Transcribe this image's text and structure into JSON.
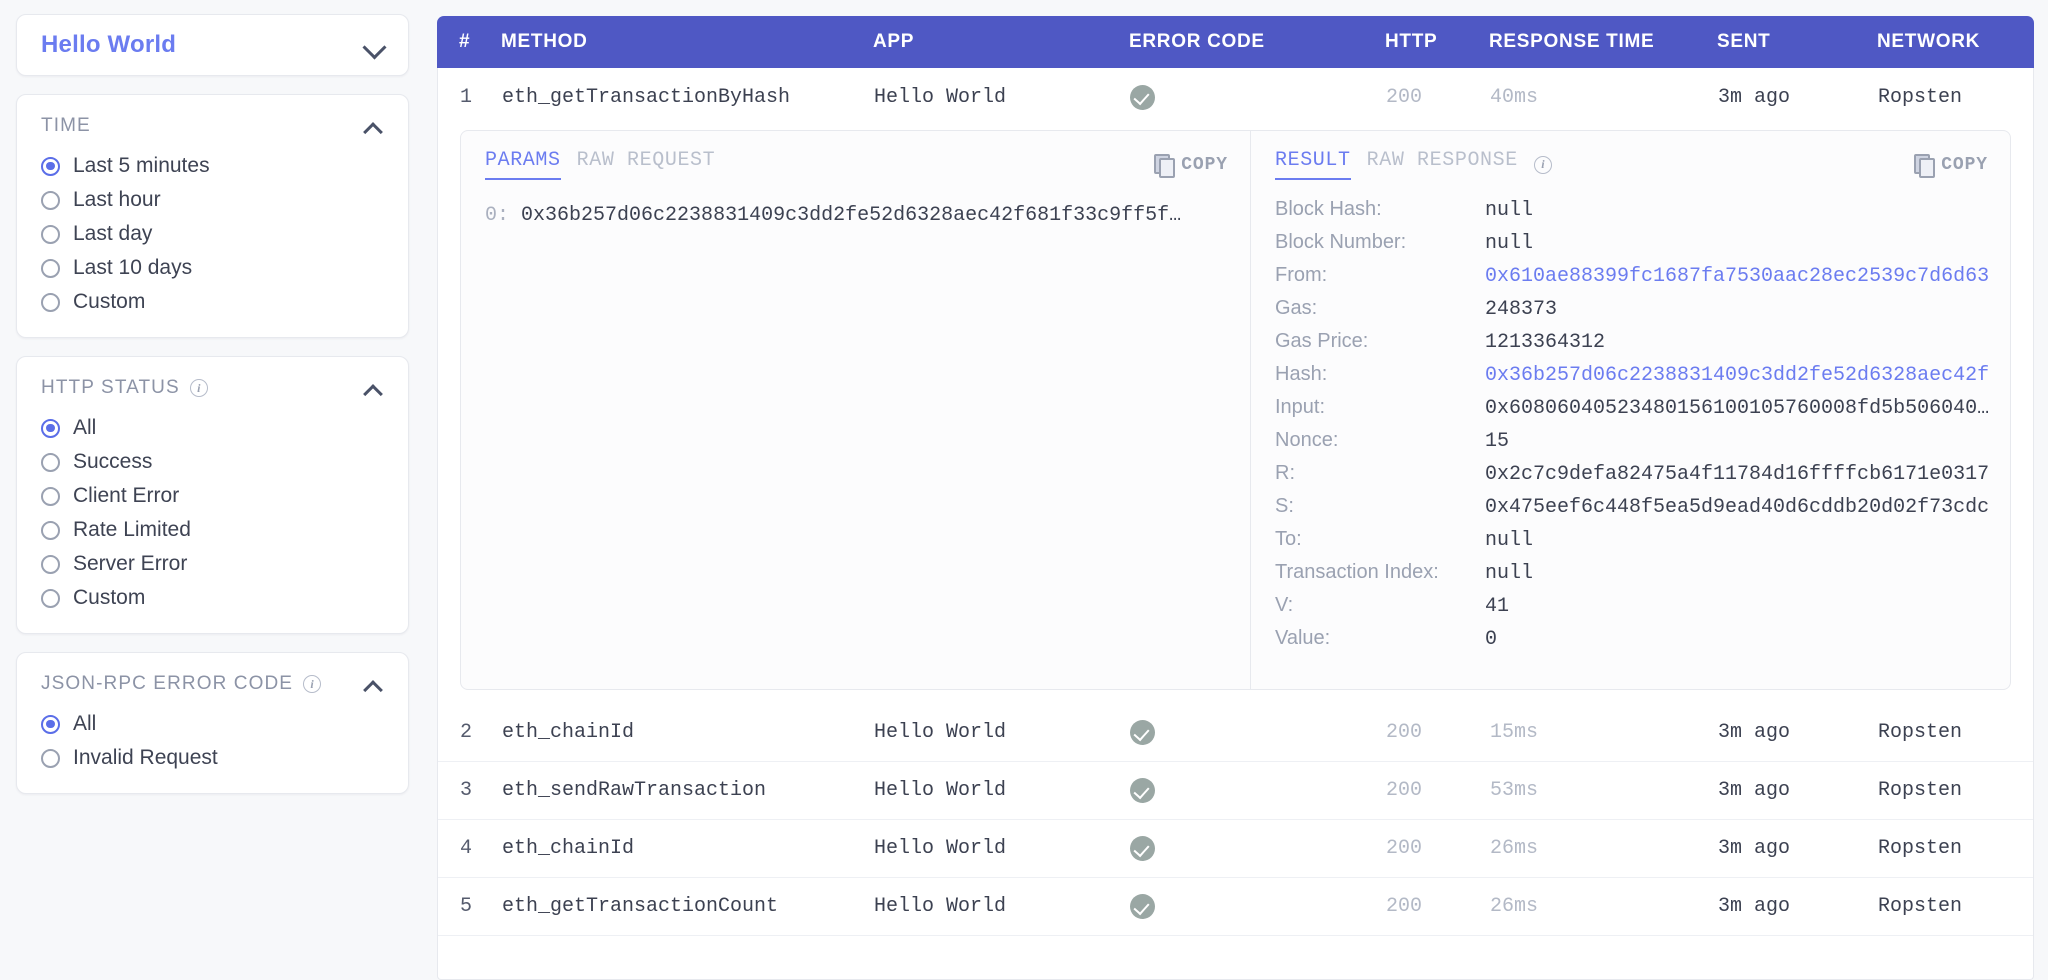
{
  "sidebar": {
    "app_selector": {
      "value": "Hello World",
      "chevron": "chevron-down-icon"
    },
    "sections": [
      {
        "title": "TIME",
        "has_info": false,
        "collapsed": false,
        "options": [
          {
            "label": "Last 5 minutes",
            "selected": true
          },
          {
            "label": "Last hour",
            "selected": false
          },
          {
            "label": "Last day",
            "selected": false
          },
          {
            "label": "Last 10 days",
            "selected": false
          },
          {
            "label": "Custom",
            "selected": false
          }
        ]
      },
      {
        "title": "HTTP STATUS",
        "has_info": true,
        "collapsed": false,
        "options": [
          {
            "label": "All",
            "selected": true
          },
          {
            "label": "Success",
            "selected": false
          },
          {
            "label": "Client Error",
            "selected": false
          },
          {
            "label": "Rate Limited",
            "selected": false
          },
          {
            "label": "Server Error",
            "selected": false
          },
          {
            "label": "Custom",
            "selected": false
          }
        ]
      },
      {
        "title": "JSON-RPC ERROR CODE",
        "has_info": true,
        "collapsed": false,
        "options": [
          {
            "label": "All",
            "selected": true
          },
          {
            "label": "Invalid Request",
            "selected": false
          }
        ]
      }
    ]
  },
  "table": {
    "columns": {
      "num": "#",
      "method": "METHOD",
      "app": "APP",
      "error_code": "ERROR CODE",
      "http": "HTTP",
      "response_time": "RESPONSE TIME",
      "sent": "SENT",
      "network": "NETWORK"
    },
    "header_bg": "#4f58c4",
    "rows": [
      {
        "num": "1",
        "method": "eth_getTransactionByHash",
        "app": "Hello World",
        "status_icon": "success-check-icon",
        "http": "200",
        "response_time": "40ms",
        "sent": "3m ago",
        "network": "Ropsten",
        "expanded": true
      },
      {
        "num": "2",
        "method": "eth_chainId",
        "app": "Hello World",
        "status_icon": "success-check-icon",
        "http": "200",
        "response_time": "15ms",
        "sent": "3m ago",
        "network": "Ropsten",
        "expanded": false
      },
      {
        "num": "3",
        "method": "eth_sendRawTransaction",
        "app": "Hello World",
        "status_icon": "success-check-icon",
        "http": "200",
        "response_time": "53ms",
        "sent": "3m ago",
        "network": "Ropsten",
        "expanded": false
      },
      {
        "num": "4",
        "method": "eth_chainId",
        "app": "Hello World",
        "status_icon": "success-check-icon",
        "http": "200",
        "response_time": "26ms",
        "sent": "3m ago",
        "network": "Ropsten",
        "expanded": false
      },
      {
        "num": "5",
        "method": "eth_getTransactionCount",
        "app": "Hello World",
        "status_icon": "success-check-icon",
        "http": "200",
        "response_time": "26ms",
        "sent": "3m ago",
        "network": "Ropsten",
        "expanded": false
      }
    ]
  },
  "detail": {
    "request": {
      "tabs": [
        {
          "label": "PARAMS",
          "active": true
        },
        {
          "label": "RAW REQUEST",
          "active": false
        }
      ],
      "copy_label": "COPY",
      "params": [
        {
          "index": "0:",
          "value": "0x36b257d06c2238831409c3dd2fe52d6328aec42f681f33c9ff5f…"
        }
      ]
    },
    "response": {
      "tabs": [
        {
          "label": "RESULT",
          "active": true
        },
        {
          "label": "RAW RESPONSE",
          "active": false
        }
      ],
      "has_info": true,
      "copy_label": "COPY",
      "fields": [
        {
          "key": "Block Hash:",
          "value": "null",
          "link": false
        },
        {
          "key": "Block Number:",
          "value": "null",
          "link": false
        },
        {
          "key": "From:",
          "value": "0x610ae88399fc1687fa7530aac28ec2539c7d6d63",
          "link": true
        },
        {
          "key": "Gas:",
          "value": "248373",
          "link": false
        },
        {
          "key": "Gas Price:",
          "value": "1213364312",
          "link": false
        },
        {
          "key": "Hash:",
          "value": "0x36b257d06c2238831409c3dd2fe52d6328aec42f…",
          "link": true
        },
        {
          "key": "Input:",
          "value": "0x60806040523480156100105760008fd5b506040…",
          "link": false
        },
        {
          "key": "Nonce:",
          "value": "15",
          "link": false
        },
        {
          "key": "R:",
          "value": "0x2c7c9defa82475a4f11784d16ffffcb6171e0317…",
          "link": false
        },
        {
          "key": "S:",
          "value": "0x475eef6c448f5ea5d9ead40d6cddb20d02f73cdc…",
          "link": false
        },
        {
          "key": "To:",
          "value": "null",
          "link": false
        },
        {
          "key": "Transaction Index:",
          "value": "null",
          "link": false
        },
        {
          "key": "V:",
          "value": "41",
          "link": false
        },
        {
          "key": "Value:",
          "value": "0",
          "link": false
        }
      ]
    }
  }
}
